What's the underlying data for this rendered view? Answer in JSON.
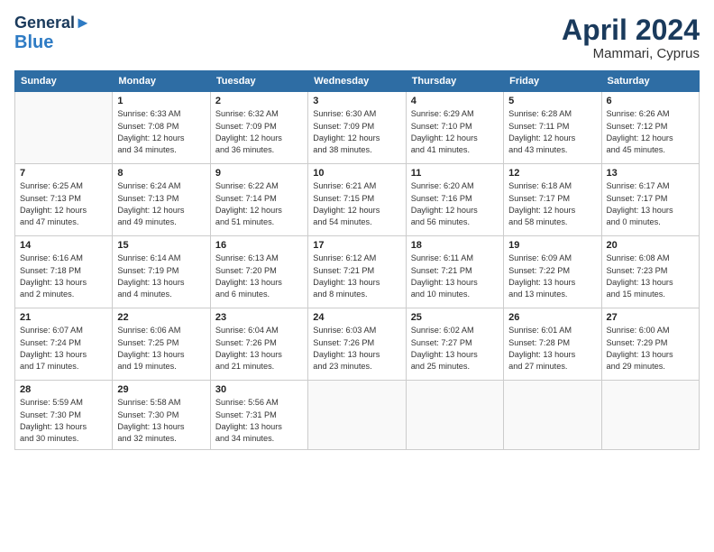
{
  "header": {
    "logo_line1": "General",
    "logo_line2": "Blue",
    "month": "April 2024",
    "location": "Mammari, Cyprus"
  },
  "weekdays": [
    "Sunday",
    "Monday",
    "Tuesday",
    "Wednesday",
    "Thursday",
    "Friday",
    "Saturday"
  ],
  "weeks": [
    [
      {
        "day": "",
        "info": ""
      },
      {
        "day": "1",
        "info": "Sunrise: 6:33 AM\nSunset: 7:08 PM\nDaylight: 12 hours\nand 34 minutes."
      },
      {
        "day": "2",
        "info": "Sunrise: 6:32 AM\nSunset: 7:09 PM\nDaylight: 12 hours\nand 36 minutes."
      },
      {
        "day": "3",
        "info": "Sunrise: 6:30 AM\nSunset: 7:09 PM\nDaylight: 12 hours\nand 38 minutes."
      },
      {
        "day": "4",
        "info": "Sunrise: 6:29 AM\nSunset: 7:10 PM\nDaylight: 12 hours\nand 41 minutes."
      },
      {
        "day": "5",
        "info": "Sunrise: 6:28 AM\nSunset: 7:11 PM\nDaylight: 12 hours\nand 43 minutes."
      },
      {
        "day": "6",
        "info": "Sunrise: 6:26 AM\nSunset: 7:12 PM\nDaylight: 12 hours\nand 45 minutes."
      }
    ],
    [
      {
        "day": "7",
        "info": "Sunrise: 6:25 AM\nSunset: 7:13 PM\nDaylight: 12 hours\nand 47 minutes."
      },
      {
        "day": "8",
        "info": "Sunrise: 6:24 AM\nSunset: 7:13 PM\nDaylight: 12 hours\nand 49 minutes."
      },
      {
        "day": "9",
        "info": "Sunrise: 6:22 AM\nSunset: 7:14 PM\nDaylight: 12 hours\nand 51 minutes."
      },
      {
        "day": "10",
        "info": "Sunrise: 6:21 AM\nSunset: 7:15 PM\nDaylight: 12 hours\nand 54 minutes."
      },
      {
        "day": "11",
        "info": "Sunrise: 6:20 AM\nSunset: 7:16 PM\nDaylight: 12 hours\nand 56 minutes."
      },
      {
        "day": "12",
        "info": "Sunrise: 6:18 AM\nSunset: 7:17 PM\nDaylight: 12 hours\nand 58 minutes."
      },
      {
        "day": "13",
        "info": "Sunrise: 6:17 AM\nSunset: 7:17 PM\nDaylight: 13 hours\nand 0 minutes."
      }
    ],
    [
      {
        "day": "14",
        "info": "Sunrise: 6:16 AM\nSunset: 7:18 PM\nDaylight: 13 hours\nand 2 minutes."
      },
      {
        "day": "15",
        "info": "Sunrise: 6:14 AM\nSunset: 7:19 PM\nDaylight: 13 hours\nand 4 minutes."
      },
      {
        "day": "16",
        "info": "Sunrise: 6:13 AM\nSunset: 7:20 PM\nDaylight: 13 hours\nand 6 minutes."
      },
      {
        "day": "17",
        "info": "Sunrise: 6:12 AM\nSunset: 7:21 PM\nDaylight: 13 hours\nand 8 minutes."
      },
      {
        "day": "18",
        "info": "Sunrise: 6:11 AM\nSunset: 7:21 PM\nDaylight: 13 hours\nand 10 minutes."
      },
      {
        "day": "19",
        "info": "Sunrise: 6:09 AM\nSunset: 7:22 PM\nDaylight: 13 hours\nand 13 minutes."
      },
      {
        "day": "20",
        "info": "Sunrise: 6:08 AM\nSunset: 7:23 PM\nDaylight: 13 hours\nand 15 minutes."
      }
    ],
    [
      {
        "day": "21",
        "info": "Sunrise: 6:07 AM\nSunset: 7:24 PM\nDaylight: 13 hours\nand 17 minutes."
      },
      {
        "day": "22",
        "info": "Sunrise: 6:06 AM\nSunset: 7:25 PM\nDaylight: 13 hours\nand 19 minutes."
      },
      {
        "day": "23",
        "info": "Sunrise: 6:04 AM\nSunset: 7:26 PM\nDaylight: 13 hours\nand 21 minutes."
      },
      {
        "day": "24",
        "info": "Sunrise: 6:03 AM\nSunset: 7:26 PM\nDaylight: 13 hours\nand 23 minutes."
      },
      {
        "day": "25",
        "info": "Sunrise: 6:02 AM\nSunset: 7:27 PM\nDaylight: 13 hours\nand 25 minutes."
      },
      {
        "day": "26",
        "info": "Sunrise: 6:01 AM\nSunset: 7:28 PM\nDaylight: 13 hours\nand 27 minutes."
      },
      {
        "day": "27",
        "info": "Sunrise: 6:00 AM\nSunset: 7:29 PM\nDaylight: 13 hours\nand 29 minutes."
      }
    ],
    [
      {
        "day": "28",
        "info": "Sunrise: 5:59 AM\nSunset: 7:30 PM\nDaylight: 13 hours\nand 30 minutes."
      },
      {
        "day": "29",
        "info": "Sunrise: 5:58 AM\nSunset: 7:30 PM\nDaylight: 13 hours\nand 32 minutes."
      },
      {
        "day": "30",
        "info": "Sunrise: 5:56 AM\nSunset: 7:31 PM\nDaylight: 13 hours\nand 34 minutes."
      },
      {
        "day": "",
        "info": ""
      },
      {
        "day": "",
        "info": ""
      },
      {
        "day": "",
        "info": ""
      },
      {
        "day": "",
        "info": ""
      }
    ]
  ]
}
